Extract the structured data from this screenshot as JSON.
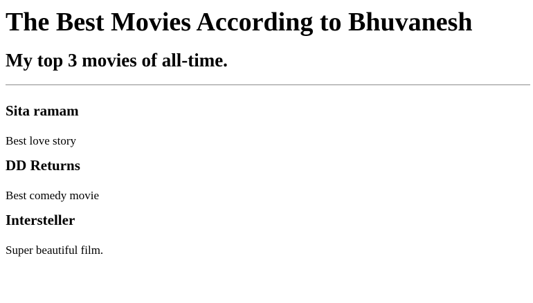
{
  "page": {
    "title": "The Best Movies According to Bhuvanesh",
    "subtitle": "My top 3 movies of all-time."
  },
  "movies": [
    {
      "name": "Sita ramam",
      "description": "Best love story"
    },
    {
      "name": "DD Returns",
      "description": "Best comedy movie"
    },
    {
      "name": "Intersteller",
      "description": "Super beautiful film."
    }
  ]
}
